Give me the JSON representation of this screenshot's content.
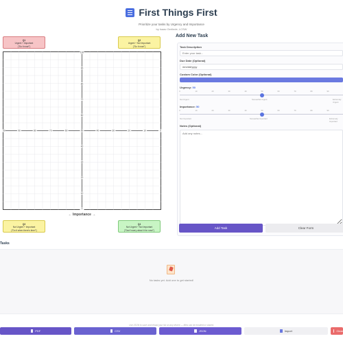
{
  "header": {
    "title": "First Things First",
    "subtitle": "Prioritize your tasks by Urgency and Importance",
    "author": "by Isaac Gerlinde, LCSW"
  },
  "quadrants": {
    "q1": {
      "num": "Q1",
      "line1": "Urgent + Important",
      "line2": "(\"Do it now!\")"
    },
    "q2": {
      "num": "Q2",
      "line1": "Urgent + Not Important",
      "line2": "(\"Do it now!\")"
    },
    "q3": {
      "num": "Q3",
      "line1": "Not Urgent + Important",
      "line2": "(\"Do it when there's time!\")"
    },
    "q4": {
      "num": "Q4",
      "line1": "Not Urgent + Not Important",
      "line2": "(\"Don't worry about it for now!\")"
    }
  },
  "matrix": {
    "x_axis_label": "← Importance →",
    "x_ticks": [
      "100",
      "90",
      "80",
      "70",
      "60",
      "50",
      "40",
      "30",
      "20",
      "10",
      "0"
    ],
    "y_ticks": [
      "100",
      "90",
      "80",
      "70",
      "60",
      "50",
      "40",
      "30",
      "20",
      "10",
      "0"
    ]
  },
  "form": {
    "title": "Add New Task",
    "task_description_label": "Task Description",
    "task_description_placeholder": "Enter your task...",
    "due_date_label": "Due Date (Optional)",
    "due_date_value": "mm/dd/yyyy",
    "custom_color_label": "Custom Color (Optional)",
    "custom_color": "#6a79e0",
    "urgency_label": "Urgency:",
    "urgency_value": "50",
    "urgency_fraction": 0.5,
    "urgency_ticks": [
      "0",
      "10",
      "20",
      "30",
      "40",
      "50",
      "60",
      "70",
      "80",
      "90",
      "100"
    ],
    "urgency_captions": {
      "left": "Not Urgent",
      "mid": "Somewhat Urgent",
      "right": "Extremely Urgent"
    },
    "importance_label": "Importance:",
    "importance_value": "50",
    "importance_fraction": 0.5,
    "importance_ticks": [
      "0",
      "10",
      "20",
      "30",
      "40",
      "50",
      "60",
      "70",
      "80",
      "90",
      "100"
    ],
    "importance_captions": {
      "left": "Not Important",
      "mid": "Somewhat Important",
      "right": "Extremely Important"
    },
    "notes_label": "Notes (Optional)",
    "notes_placeholder": "Add any notes...",
    "add_button": "Add Task",
    "clear_button": "Clear Form"
  },
  "tasks": {
    "title": "Tasks",
    "empty_text": "No tasks yet. Add one to get started!"
  },
  "footer": {
    "note": "Use JSON to save and reload your list on any device — titles can be emailed or shared.",
    "pdf": "PDF",
    "csv": "CSV",
    "json": "JSON",
    "import": "Import",
    "clear": "Clear"
  },
  "colors": {
    "accent": "#5b74e0",
    "primary_button": "#6755c7",
    "danger": "#ea6b6b",
    "q1_bg": "#f7c4c6",
    "q2_bg": "#fbf3a2",
    "q4_bg": "#c8f5c4"
  }
}
